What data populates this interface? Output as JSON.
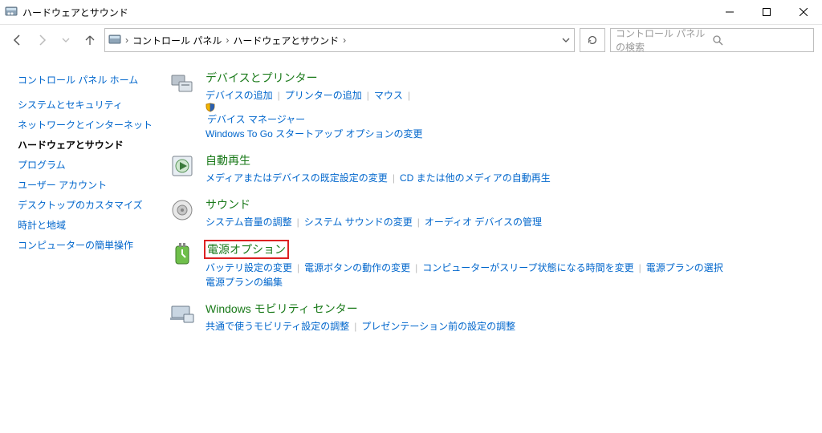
{
  "window": {
    "title": "ハードウェアとサウンド"
  },
  "breadcrumb": {
    "root": "コントロール パネル",
    "current": "ハードウェアとサウンド"
  },
  "search": {
    "placeholder": "コントロール パネルの検索"
  },
  "sidebar": {
    "home": "コントロール パネル ホーム",
    "items": [
      "システムとセキュリティ",
      "ネットワークとインターネット",
      "ハードウェアとサウンド",
      "プログラム",
      "ユーザー アカウント",
      "デスクトップのカスタマイズ",
      "時計と地域",
      "コンピューターの簡単操作"
    ],
    "active_index": 2
  },
  "categories": [
    {
      "icon": "devices-printers",
      "title": "デバイスとプリンター",
      "links": [
        {
          "t": "デバイスの追加"
        },
        {
          "t": "プリンターの追加"
        },
        {
          "t": "マウス"
        },
        {
          "t": "デバイス マネージャー",
          "shield": true
        }
      ],
      "links2": [
        {
          "t": "Windows To Go スタートアップ オプションの変更"
        }
      ]
    },
    {
      "icon": "autoplay",
      "title": "自動再生",
      "links": [
        {
          "t": "メディアまたはデバイスの既定設定の変更"
        },
        {
          "t": "CD または他のメディアの自動再生"
        }
      ]
    },
    {
      "icon": "sound",
      "title": "サウンド",
      "links": [
        {
          "t": "システム音量の調整"
        },
        {
          "t": "システム サウンドの変更"
        },
        {
          "t": "オーディオ デバイスの管理"
        }
      ]
    },
    {
      "icon": "power",
      "title": "電源オプション",
      "highlight_title": true,
      "links": [
        {
          "t": "バッテリ設定の変更"
        },
        {
          "t": "電源ボタンの動作の変更"
        },
        {
          "t": "コンピューターがスリープ状態になる時間を変更"
        },
        {
          "t": "電源プランの選択"
        }
      ],
      "links2": [
        {
          "t": "電源プランの編集"
        }
      ]
    },
    {
      "icon": "mobility",
      "title": "Windows モビリティ センター",
      "links": [
        {
          "t": "共通で使うモビリティ設定の調整"
        },
        {
          "t": "プレゼンテーション前の設定の調整"
        }
      ]
    }
  ]
}
